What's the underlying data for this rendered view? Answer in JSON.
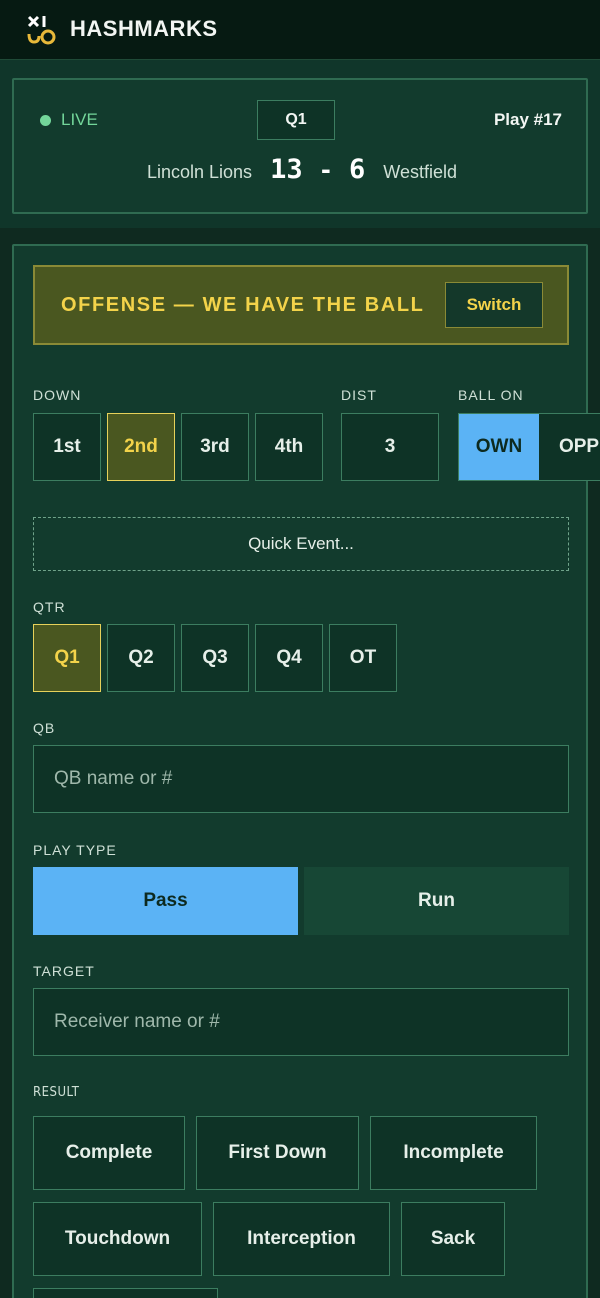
{
  "app": {
    "brand": "HASHMARKS"
  },
  "scoreboard": {
    "live_label": "LIVE",
    "quarter": "Q1",
    "play": "Play #17",
    "home_team": "Lincoln Lions",
    "home_score": "13",
    "separator": "-",
    "away_score": "6",
    "away_team": "Westfield"
  },
  "possession": {
    "label": "OFFENSE — WE HAVE THE BALL",
    "switch_label": "Switch"
  },
  "down": {
    "label": "DOWN",
    "options": [
      "1st",
      "2nd",
      "3rd",
      "4th"
    ],
    "selected": "2nd"
  },
  "dist": {
    "label": "DIST",
    "value": "3"
  },
  "ball_on": {
    "label": "BALL ON",
    "options": [
      "OWN",
      "OPP"
    ],
    "selected": "OWN"
  },
  "quick_event": {
    "label": "Quick Event..."
  },
  "qtr": {
    "label": "QTR",
    "options": [
      "Q1",
      "Q2",
      "Q3",
      "Q4",
      "OT"
    ],
    "selected": "Q1"
  },
  "qb": {
    "label": "QB",
    "placeholder": "QB name or #"
  },
  "play_type": {
    "label": "PLAY TYPE",
    "options": [
      "Pass",
      "Run"
    ],
    "selected": "Pass"
  },
  "target": {
    "label": "TARGET",
    "placeholder": "Receiver name or #"
  },
  "result": {
    "label": "RESULT",
    "options": [
      "Complete",
      "First Down",
      "Incomplete",
      "Touchdown",
      "Interception",
      "Sack"
    ]
  },
  "colors": {
    "accent_yellow": "#f3d34a",
    "accent_blue": "#5bb3f5",
    "live_green": "#73d69a",
    "background": "#0f2a20"
  }
}
